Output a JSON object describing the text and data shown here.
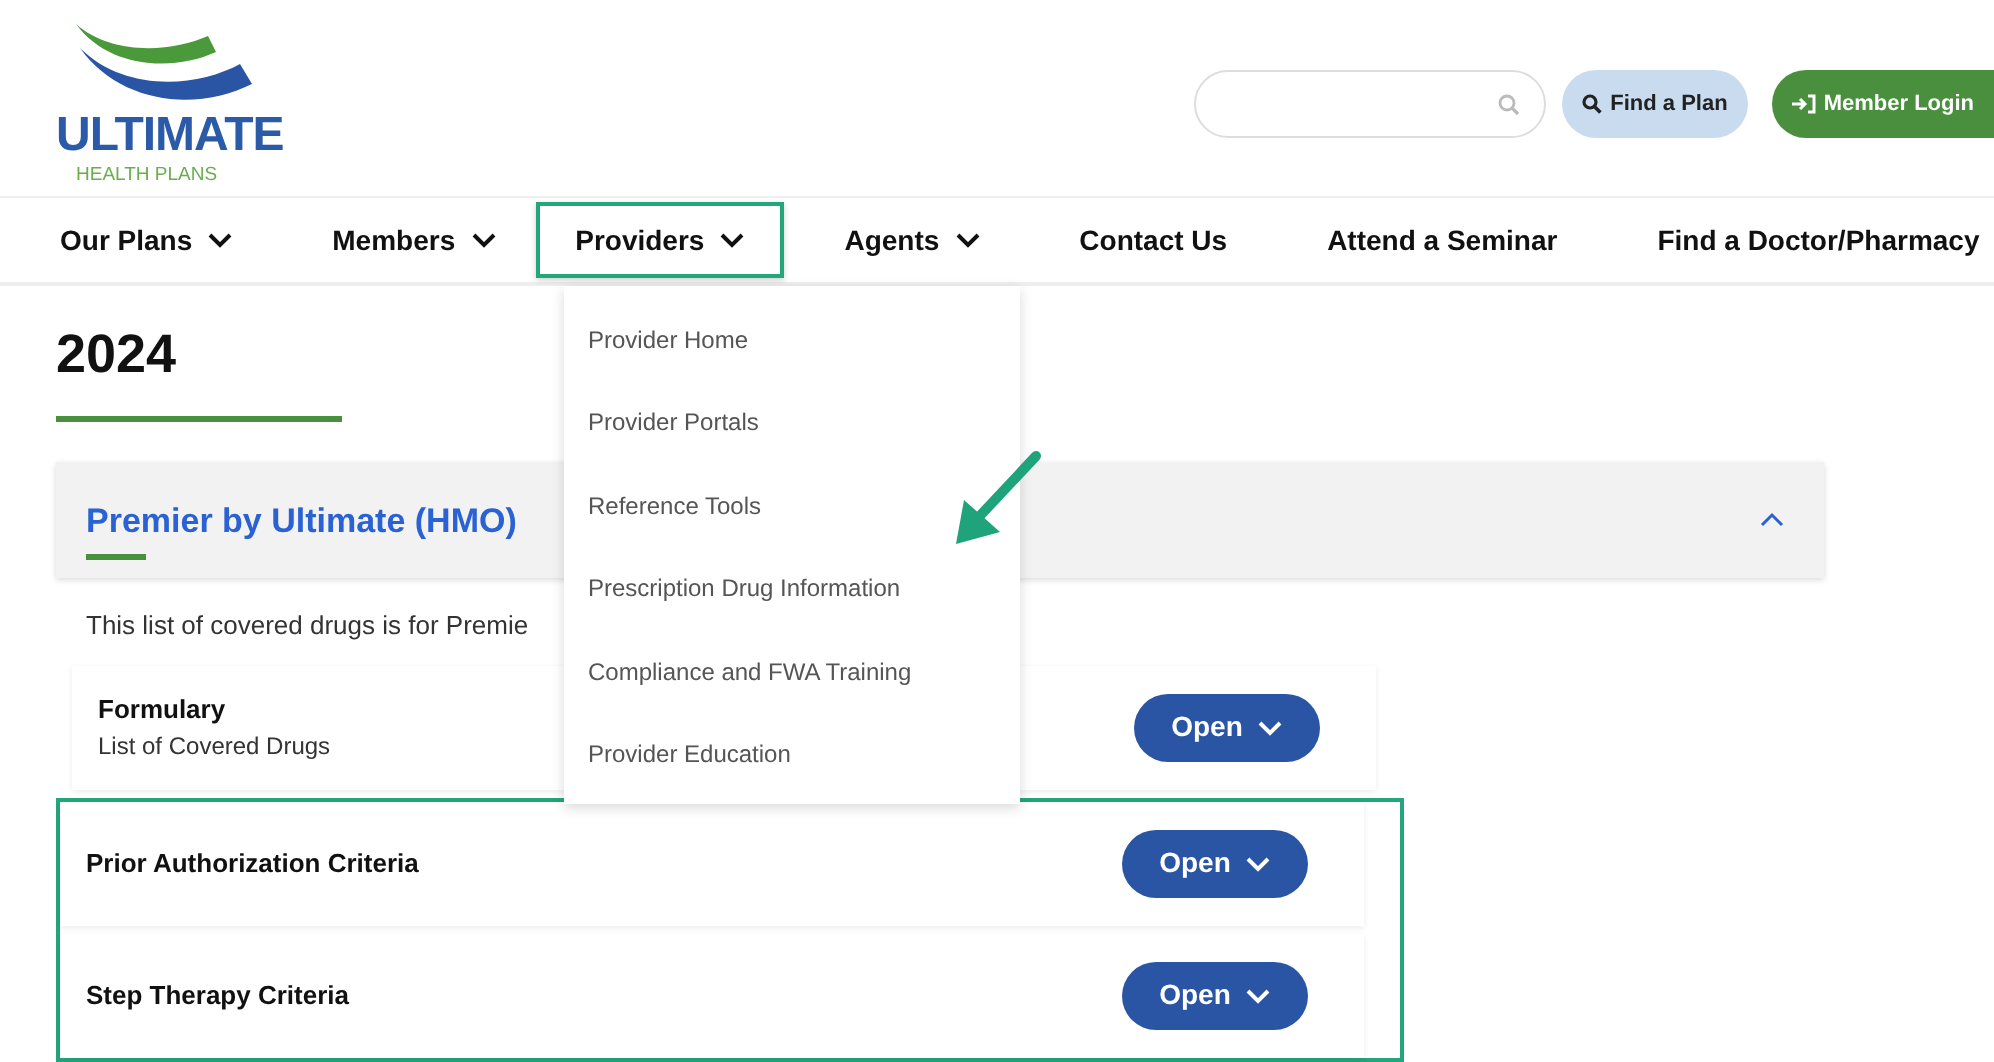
{
  "logo": {
    "name": "ULTIMATE",
    "tagline": "HEALTH PLANS"
  },
  "header_buttons": [
    {
      "kind": "find",
      "label": "Find a Plan"
    },
    {
      "kind": "login",
      "label": "Member Login"
    }
  ],
  "nav": [
    {
      "label": "Our Plans",
      "has_menu": true,
      "highlighted": false
    },
    {
      "label": "Members",
      "has_menu": true,
      "highlighted": false
    },
    {
      "label": "Providers",
      "has_menu": true,
      "highlighted": true
    },
    {
      "label": "Agents",
      "has_menu": true,
      "highlighted": false
    },
    {
      "label": "Contact Us",
      "has_menu": false,
      "highlighted": false
    },
    {
      "label": "Attend a Seminar",
      "has_menu": false,
      "highlighted": false
    },
    {
      "label": "Find a Doctor/Pharmacy",
      "has_menu": false,
      "highlighted": false
    }
  ],
  "dropdown": {
    "items": [
      "Provider Home",
      "Provider Portals",
      "Reference Tools",
      "Prescription Drug Information",
      "Compliance and FWA Training",
      "Provider Education"
    ]
  },
  "heading": "2024",
  "accordion": {
    "title": "Premier by Ultimate (HMO)",
    "expanded": true,
    "intro": "This list of covered drugs is for Premie",
    "documents": [
      {
        "title": "Formulary",
        "subtitle": "List of Covered Drugs",
        "button": "Open",
        "highlighted": false
      },
      {
        "title": "Prior Authorization Criteria",
        "button": "Open",
        "highlighted": true
      },
      {
        "title": "Step Therapy Criteria",
        "button": "Open",
        "highlighted": true
      }
    ]
  }
}
